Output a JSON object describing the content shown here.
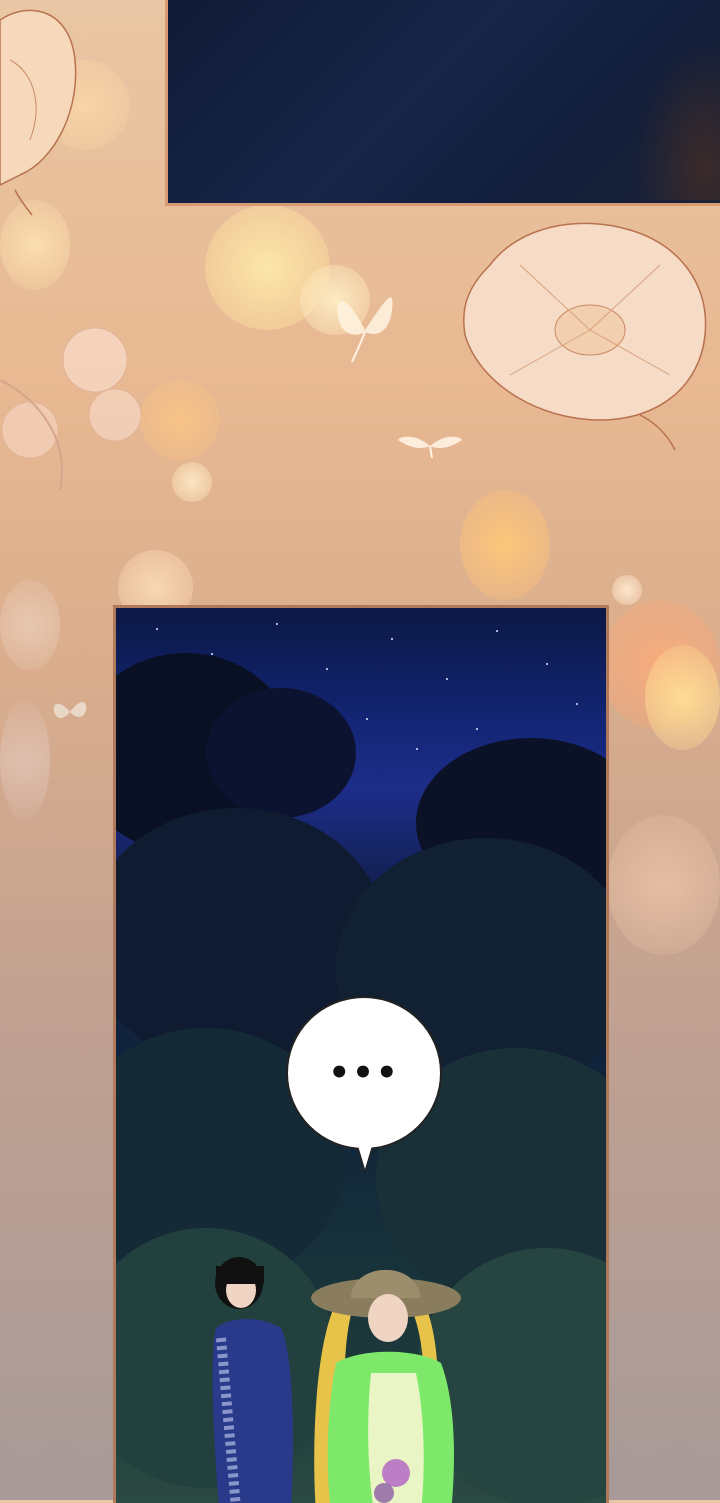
{
  "page": {
    "background_top_color": "#e9c6a5",
    "background_bottom_color": "#a79a98",
    "panel_border_color": "#d79a72"
  },
  "speech_bubble": {
    "text": "•••"
  },
  "scene": {
    "top_panel_color": "#172649",
    "night_sky_color": "#1d2d8a",
    "forest_color": "#1d3a3a"
  },
  "characters": {
    "left_figure_color": "#2a3a8a",
    "right_figure_color": "#7ee86a",
    "hat_color": "#8a7d5e",
    "hair_color": "#e8c34a"
  }
}
